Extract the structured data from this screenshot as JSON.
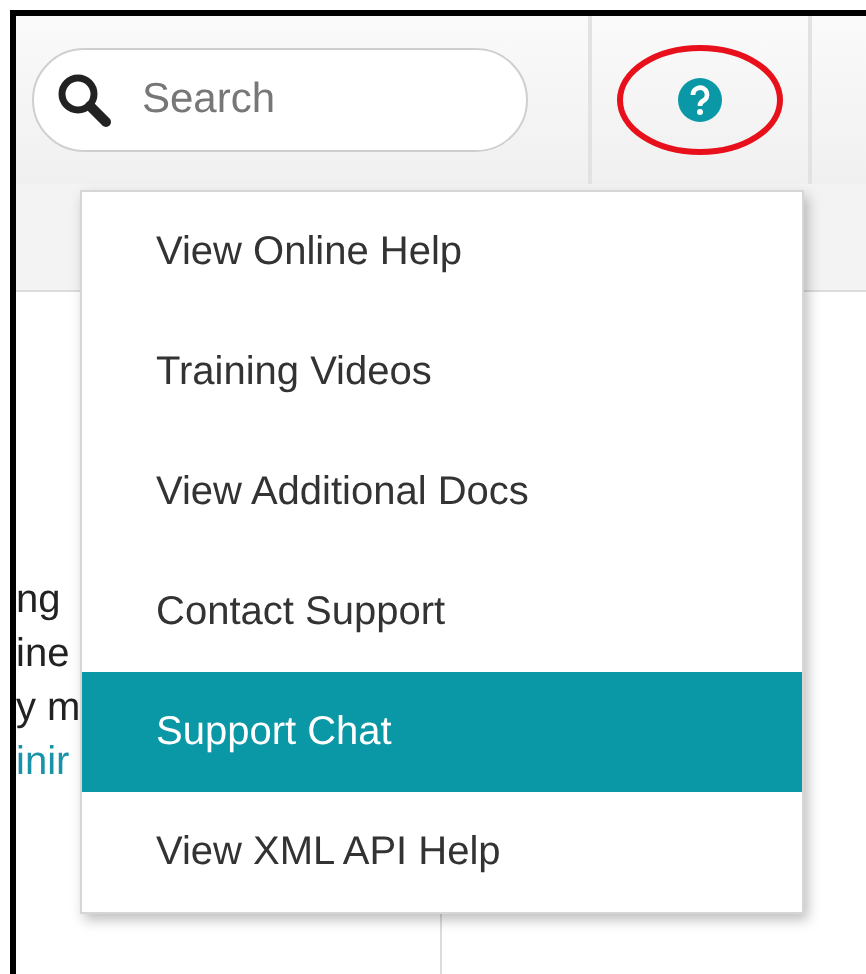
{
  "search": {
    "placeholder": "Search"
  },
  "background_text": [
    {
      "text": "ng",
      "link": false
    },
    {
      "text": "ine",
      "link": false
    },
    {
      "text": "y m",
      "link": false
    },
    {
      "text": "inir",
      "link": true
    }
  ],
  "help_menu": {
    "items": [
      {
        "label": "View Online Help",
        "selected": false
      },
      {
        "label": "Training Videos",
        "selected": false
      },
      {
        "label": "View Additional Docs",
        "selected": false
      },
      {
        "label": "Contact Support",
        "selected": false
      },
      {
        "label": "Support Chat",
        "selected": true
      },
      {
        "label": "View XML API Help",
        "selected": false
      }
    ]
  }
}
